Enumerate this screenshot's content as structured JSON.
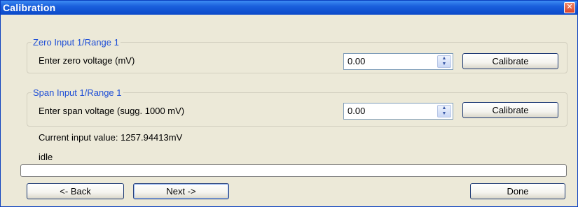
{
  "window": {
    "title": "Calibration",
    "close_glyph": "✕"
  },
  "zero_group": {
    "title": "Zero Input 1/Range 1",
    "label": "Enter zero voltage (mV)",
    "value": "0.00",
    "button": "Calibrate"
  },
  "span_group": {
    "title": "Span Input 1/Range 1",
    "label": "Enter span voltage (sugg. 1000 mV)",
    "value": "0.00",
    "button": "Calibrate"
  },
  "current_input": "Current input value: 1257.94413mV",
  "status": "idle",
  "progress": 0,
  "buttons": {
    "back": "<- Back",
    "next": "Next ->",
    "done": "Done"
  },
  "icons": {
    "spin": "spin-up-down-icon",
    "close": "close-icon"
  },
  "colors": {
    "titlebar": "#0b49c9",
    "group_title": "#1f4fd6",
    "window_bg": "#ece9d8"
  }
}
